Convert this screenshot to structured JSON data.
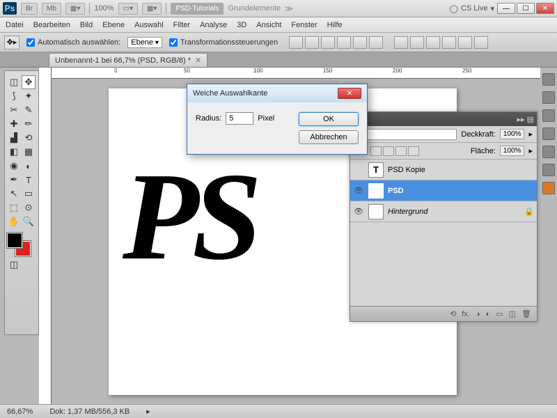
{
  "topbar": {
    "logo": "Ps",
    "btns": [
      "Br",
      "Mb"
    ],
    "zoom": "100%",
    "tabs": [
      "PSD-Tutorials",
      "Grundelemente"
    ],
    "cslive": "CS Live"
  },
  "menu": [
    "Datei",
    "Bearbeiten",
    "Bild",
    "Ebene",
    "Auswahl",
    "Filter",
    "Analyse",
    "3D",
    "Ansicht",
    "Fenster",
    "Hilfe"
  ],
  "options": {
    "auto_select": "Automatisch auswählen:",
    "auto_select_value": "Ebene",
    "transform": "Transformationssteuerungen"
  },
  "doc_tab": "Unbenannt-1 bei 66,7% (PSD, RGB/8) *",
  "canvas_text": "PS",
  "panels": {
    "opacity_label": "Deckkraft:",
    "opacity_value": "100%",
    "fill_label": "Fläche:",
    "fill_value": "100%",
    "layers": [
      {
        "name": "PSD Kopie",
        "visible": false,
        "type": "T",
        "selected": false
      },
      {
        "name": "PSD",
        "visible": true,
        "type": "T",
        "selected": true
      },
      {
        "name": "Hintergrund",
        "visible": true,
        "type": "bg",
        "selected": false,
        "locked": true,
        "italic": true
      }
    ],
    "foot_icons": [
      "⟲",
      "fx.",
      "◑",
      "◐",
      "▭",
      "◫",
      "⊡",
      "🗑"
    ]
  },
  "dialog": {
    "title": "Weiche Auswahlkante",
    "radius_label": "Radius:",
    "radius_value": "5",
    "unit": "Pixel",
    "ok": "OK",
    "cancel": "Abbrechen"
  },
  "status": {
    "zoom": "66,67%",
    "doc": "Dok: 1,37 MB/556,3 KB"
  },
  "ruler_marks": [
    "0",
    "50",
    "100",
    "150",
    "200",
    "250"
  ]
}
